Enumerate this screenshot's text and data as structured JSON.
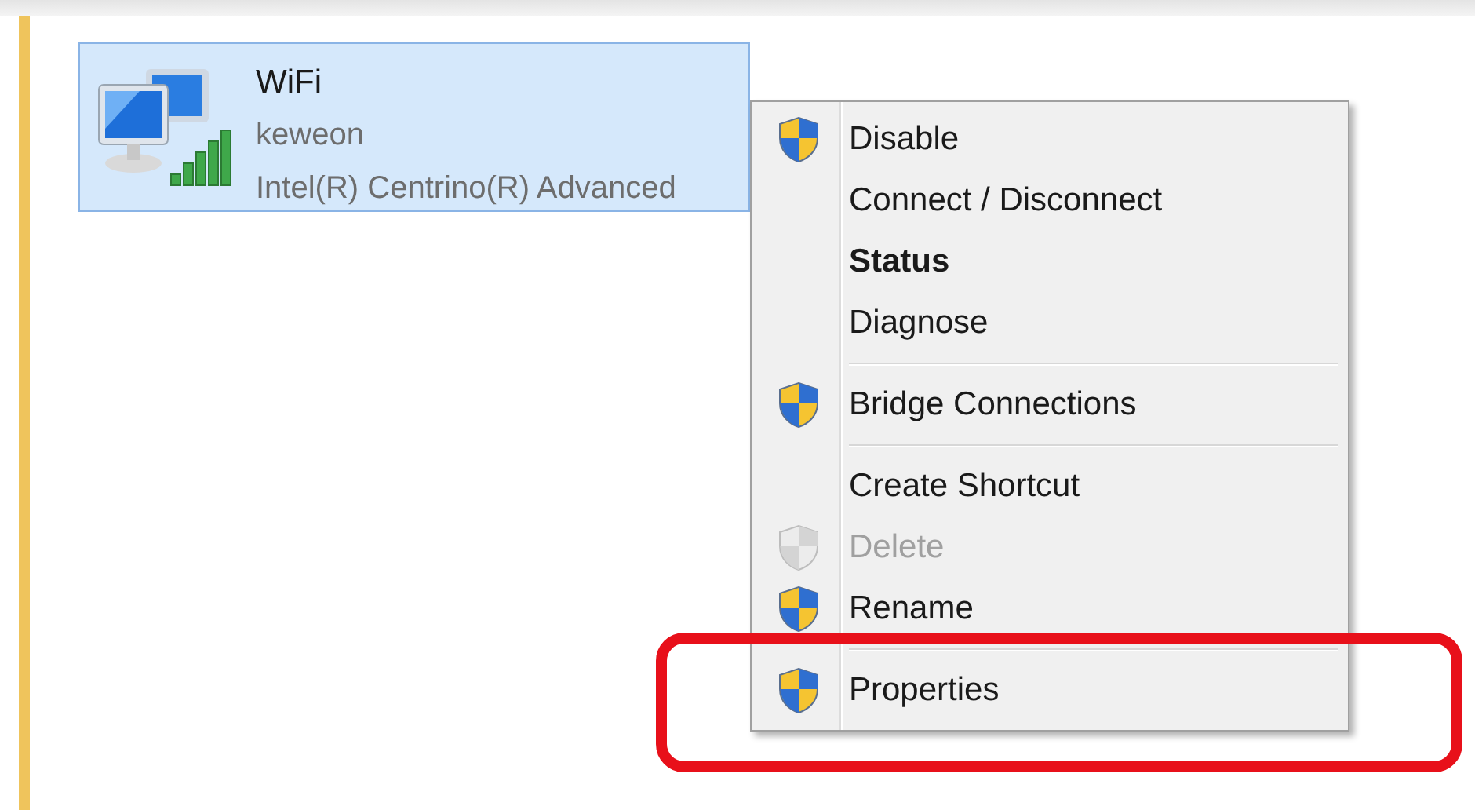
{
  "adapter": {
    "name": "WiFi",
    "network": "keweon",
    "device": "Intel(R) Centrino(R) Advanced",
    "selected": true
  },
  "context_menu": {
    "items": [
      {
        "kind": "item",
        "label": "Disable",
        "shield": true,
        "default": false,
        "disabled": false
      },
      {
        "kind": "item",
        "label": "Connect / Disconnect",
        "shield": false,
        "default": false,
        "disabled": false
      },
      {
        "kind": "item",
        "label": "Status",
        "shield": false,
        "default": true,
        "disabled": false
      },
      {
        "kind": "item",
        "label": "Diagnose",
        "shield": false,
        "default": false,
        "disabled": false
      },
      {
        "kind": "separator"
      },
      {
        "kind": "item",
        "label": "Bridge Connections",
        "shield": true,
        "default": false,
        "disabled": false
      },
      {
        "kind": "separator"
      },
      {
        "kind": "item",
        "label": "Create Shortcut",
        "shield": false,
        "default": false,
        "disabled": false
      },
      {
        "kind": "item",
        "label": "Delete",
        "shield": true,
        "default": false,
        "disabled": true
      },
      {
        "kind": "item",
        "label": "Rename",
        "shield": true,
        "default": false,
        "disabled": false
      },
      {
        "kind": "separator"
      },
      {
        "kind": "item",
        "label": "Properties",
        "shield": true,
        "default": false,
        "disabled": false,
        "highlighted": true
      }
    ]
  }
}
